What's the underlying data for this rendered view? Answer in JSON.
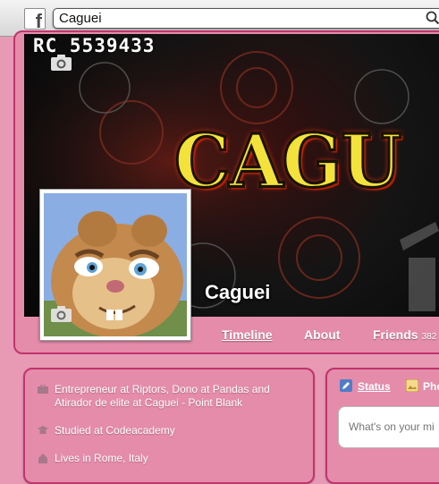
{
  "search": {
    "value": "Caguei",
    "placeholder": ""
  },
  "cover": {
    "corner_text": "RC 5539433",
    "title_art": "CAGU",
    "profile_name": "Caguei"
  },
  "tabs": [
    {
      "label": "Timeline"
    },
    {
      "label": "About"
    },
    {
      "label": "Friends",
      "count": "382"
    }
  ],
  "intro": {
    "items": [
      {
        "icon": "briefcase-icon",
        "text": "Entrepreneur at Riptors, Dono at Pandas and Atirador de elite at Caguei - Point Blank"
      },
      {
        "icon": "graduation-cap-icon",
        "text": "Studied at Codeacademy"
      },
      {
        "icon": "house-icon",
        "text": "Lives in Rome, Italy"
      }
    ]
  },
  "composer": {
    "status_label": "Status",
    "photo_label": "Pho",
    "placeholder": "What's on your mi"
  },
  "colors": {
    "page_bg": "#e89ab5",
    "panel_border": "#c2336d",
    "accent_text": "#ffffff"
  }
}
